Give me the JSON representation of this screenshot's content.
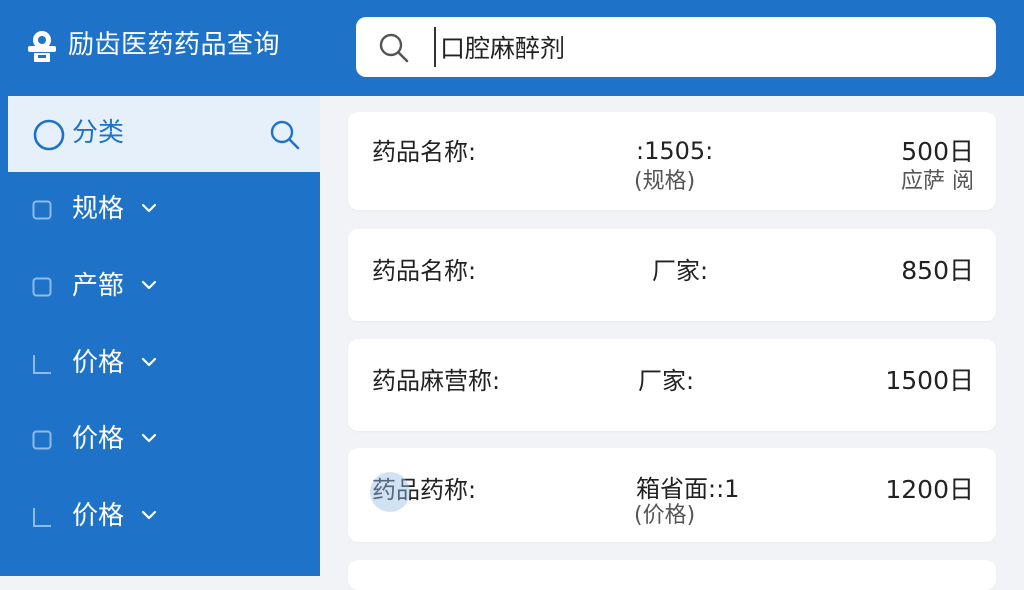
{
  "header": {
    "title": "励齿医药药品查询",
    "logo_icon": "pill-dispenser-icon",
    "bg_color": "#1e73c8"
  },
  "search": {
    "value": "口腔麻醉剂",
    "icon": "search-icon"
  },
  "sidebar": {
    "items": [
      {
        "label": "分类",
        "icon": "circle-icon",
        "active": true,
        "trailing_icon": "search-icon"
      },
      {
        "label": "规格",
        "icon": "checkbox-icon",
        "chevron": true
      },
      {
        "label": "产篰",
        "icon": "checkbox-icon",
        "chevron": true
      },
      {
        "label": "价格",
        "icon": "corner-icon",
        "chevron": true
      },
      {
        "label": "价格",
        "icon": "checkbox-icon",
        "chevron": true
      },
      {
        "label": "价格",
        "icon": "corner-icon",
        "chevron": true
      }
    ]
  },
  "results": [
    {
      "name": "药品名称:",
      "mid": ":1505:",
      "mid_sub": "(规格)",
      "price": "500日",
      "price_sub": "应萨 阅"
    },
    {
      "name": "药品名称:",
      "mid": "厂家:",
      "price": "850日"
    },
    {
      "name": "药品麻营称:",
      "mid": "厂家:",
      "price": "1500日"
    },
    {
      "name": "药品药称:",
      "mid": "箱省面::1",
      "mid_sub": "(价格)",
      "price": "1200日"
    }
  ]
}
